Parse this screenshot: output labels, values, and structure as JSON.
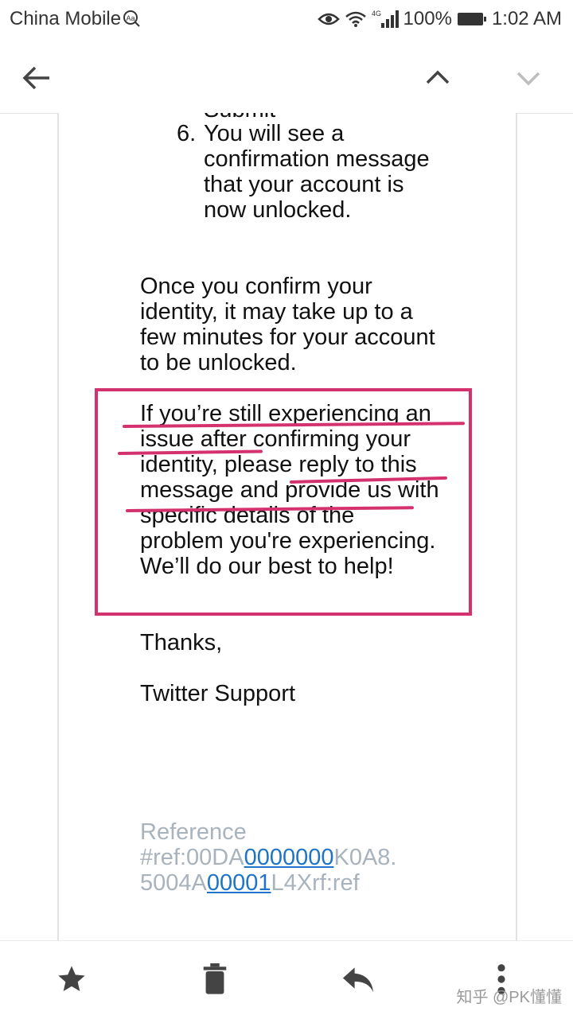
{
  "status_bar": {
    "carrier": "China Mobile",
    "network": "4G",
    "battery": "100%",
    "time": "1:02 AM"
  },
  "toolbar": {
    "back_icon": "arrow-left-icon",
    "prev_icon": "chevron-up-icon",
    "next_icon": "chevron-down-icon"
  },
  "email": {
    "partial_top": "Submit",
    "list_item_number": "6.",
    "list_item_text": "You will see a confirmation message that your account is now unlocked.",
    "paragraph_confirm": "Once you confirm your identity, it may take up to a few minutes for your account to be unlocked.",
    "paragraph_issue": "If you’re still experiencing an issue after confirming your identity, please reply to this message and provide us with specific details of the problem you're experiencing. We’ll do our best to help!",
    "thanks": "Thanks,",
    "signature": "Twitter Support",
    "reference": {
      "label": "Reference",
      "prefix": "#ref:00DA",
      "link1": "0000000",
      "middle": "K0A8.",
      "line3_prefix": "5004A",
      "link2": "00001",
      "suffix": "L4Xrf:ref"
    }
  },
  "bottom_bar": {
    "star_icon": "star-icon",
    "delete_icon": "trash-icon",
    "reply_icon": "reply-icon",
    "more_icon": "more-vertical-icon",
    "watermark": "知乎 @PK懂懂"
  },
  "colors": {
    "annotation": "#d4326e",
    "reference_text": "#a9b3bd",
    "link": "#1f74c7"
  }
}
